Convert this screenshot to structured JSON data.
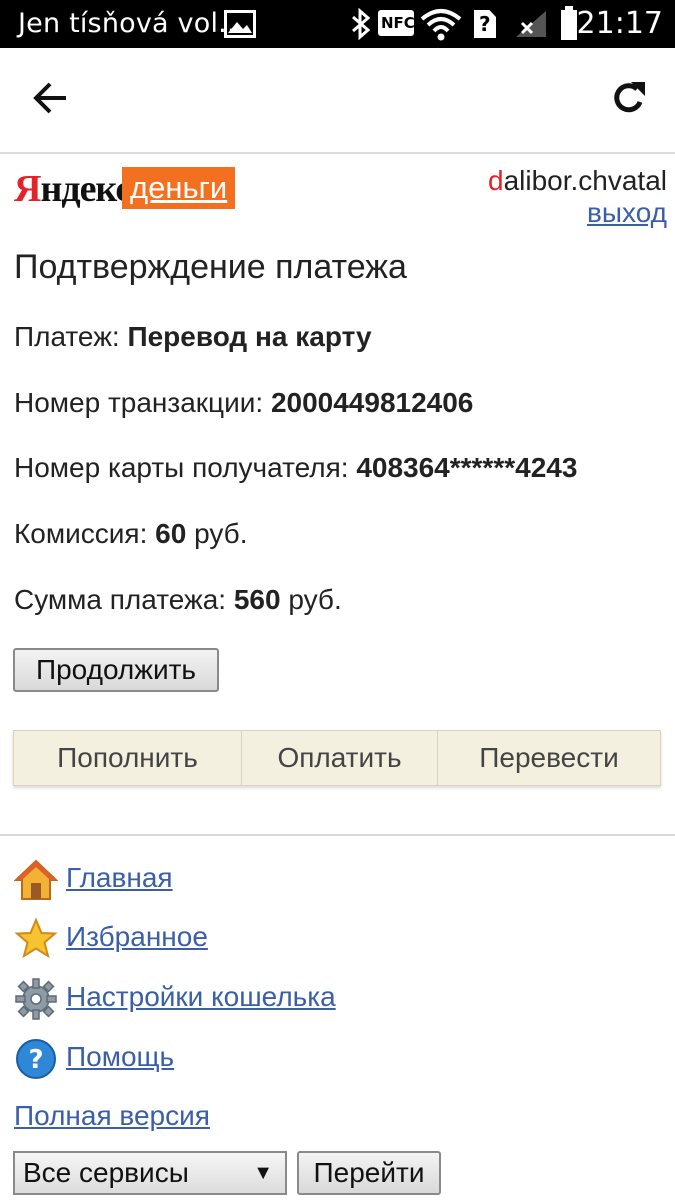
{
  "statusbar": {
    "notification_title": "Jen tísňová vol...",
    "time": "21:17",
    "icons": [
      "image-icon",
      "bluetooth-icon",
      "nfc-icon",
      "wifi-icon",
      "unknown-sim-icon",
      "no-signal-icon",
      "battery-icon"
    ],
    "nfc_label": "NFC"
  },
  "toolbar": {
    "back_icon": "arrow-back-icon",
    "reload_icon": "reload-icon"
  },
  "header": {
    "logo_yandex": "ндекс",
    "logo_yandex_first": "Я",
    "logo_dengi": "деньги",
    "username_first": "d",
    "username_rest": "alibor.chvatal",
    "logout": "выход"
  },
  "main": {
    "title": "Подтверждение платежа",
    "payment_label": "Платеж:",
    "payment_value": "Перевод на карту",
    "transaction_label": "Номер транзакции:",
    "transaction_value": "2000449812406",
    "card_label": "Номер карты получателя:",
    "card_value": "408364******4243",
    "commission_label": "Комиссия:",
    "commission_value": "60",
    "commission_unit": "руб.",
    "amount_label": "Сумма платежа:",
    "amount_value": "560",
    "amount_unit": "руб.",
    "continue_button": "Продолжить"
  },
  "tabs": [
    {
      "label": "Пополнить"
    },
    {
      "label": "Оплатить"
    },
    {
      "label": "Перевести"
    }
  ],
  "nav": [
    {
      "label": "Главная",
      "icon": "home-icon"
    },
    {
      "label": "Избранное",
      "icon": "star-icon"
    },
    {
      "label": "Настройки кошелька",
      "icon": "gear-icon"
    },
    {
      "label": "Помощь",
      "icon": "help-icon"
    }
  ],
  "footer": {
    "full_version": "Полная версия",
    "services_select": "Все сервисы",
    "go_button": "Перейти"
  },
  "colors": {
    "brand_red": "#e4222a",
    "brand_orange": "#f37021",
    "link_blue": "#3b5ea8",
    "tabs_bg": "#f3f0e0"
  }
}
